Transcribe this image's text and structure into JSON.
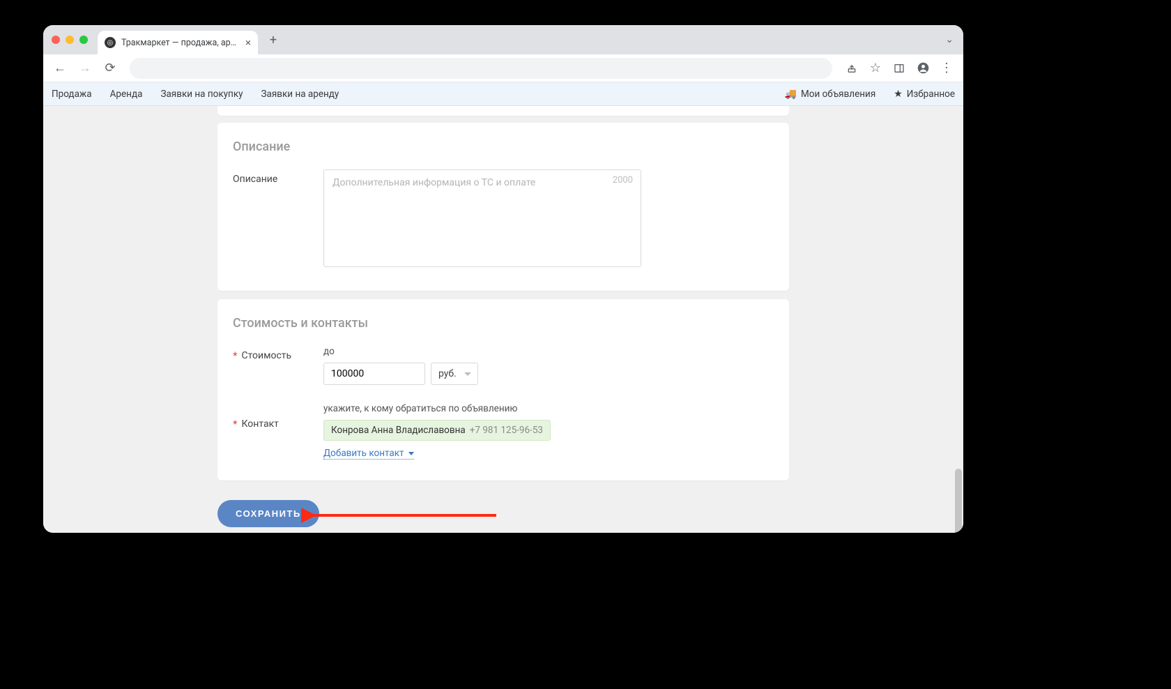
{
  "browser": {
    "tab_title": "Тракмаркет — продажа, арен"
  },
  "appnav": {
    "left": [
      "Продажа",
      "Аренда",
      "Заявки на покупку",
      "Заявки на аренду"
    ],
    "my_ads": "Мои объявления",
    "favorites": "Избранное"
  },
  "sections": {
    "description": {
      "title": "Описание",
      "label": "Описание",
      "placeholder": "Дополнительная информация о ТС и оплате",
      "counter": "2000",
      "value": ""
    },
    "price_contacts": {
      "title": "Стоимость и контакты",
      "price": {
        "label": "Стоимость",
        "prefix": "до",
        "value": "100000",
        "currency": "руб."
      },
      "contact": {
        "label": "Контакт",
        "hint": "укажите, к кому обратиться по объявлению",
        "name": "Конрова Анна Владиславовна",
        "phone": "+7 981 125-96-53",
        "add_link": "Добавить контакт"
      }
    }
  },
  "save_button": "СОХРАНИТЬ"
}
